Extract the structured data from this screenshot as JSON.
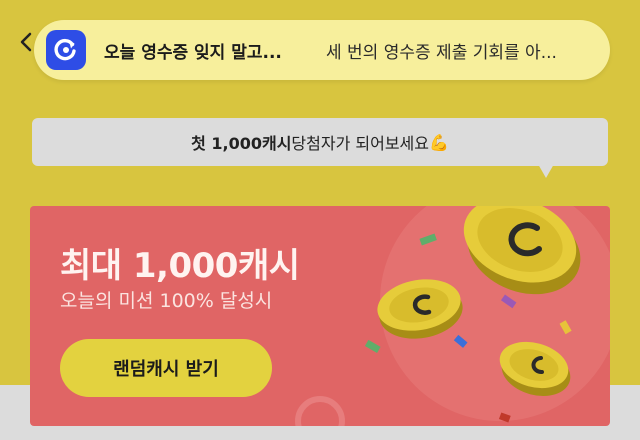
{
  "notification": {
    "title": "오늘 영수증 잊지 말고...",
    "body": "세 번의 영수증 제출 기회를 아...",
    "icon": "refresh-cash-icon",
    "icon_color": "#2e4de6"
  },
  "tooltip": {
    "highlight": "첫 1,000캐시",
    "text": " 당첨자가 되어보세요 ",
    "emoji": "💪"
  },
  "card": {
    "title": "최대 1,000캐시",
    "subtitle": "오늘의 미션 100% 달성시",
    "button_label": "랜덤캐시 받기",
    "background_color": "#e06565",
    "button_color": "#e3d23f"
  }
}
